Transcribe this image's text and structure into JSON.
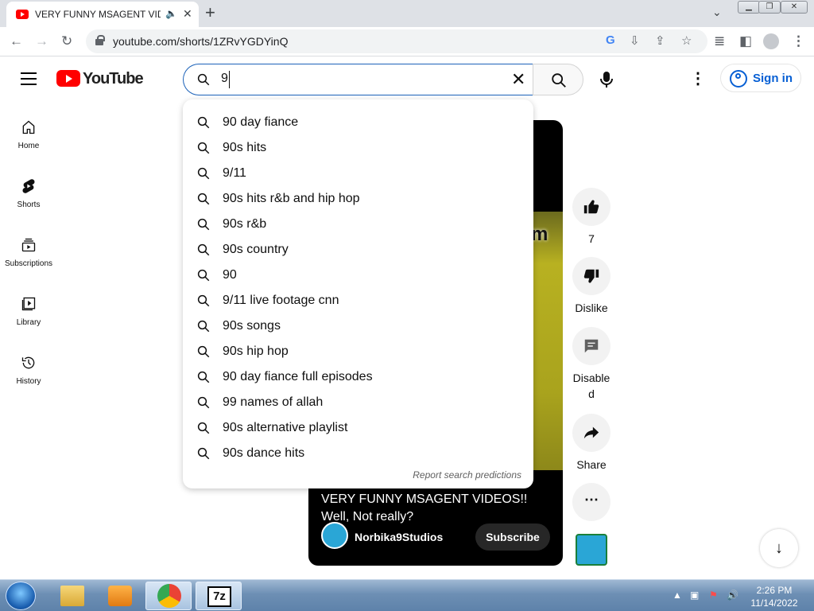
{
  "browser": {
    "tab_title": "VERY FUNNY MSAGENT VIDEOS!! Well, Not really?",
    "new_tab": "+",
    "url": "youtube.com/shorts/1ZRvYGDYinQ",
    "window_buttons": [
      "minimize",
      "restore",
      "close"
    ]
  },
  "youtube": {
    "logo_text": "YouTube",
    "search_query": "9",
    "sign_in": "Sign in",
    "guide": [
      {
        "label": "Home",
        "icon": "home-icon"
      },
      {
        "label": "Shorts",
        "icon": "shorts-icon"
      },
      {
        "label": "Subscriptions",
        "icon": "subscriptions-icon"
      },
      {
        "label": "Library",
        "icon": "library-icon"
      },
      {
        "label": "History",
        "icon": "history-icon"
      }
    ],
    "suggestions": [
      "90 day fiance",
      "90s hits",
      "9/11",
      "90s hits r&b and hip hop",
      "90s r&b",
      "90s country",
      "90",
      "9/11 live footage cnn",
      "90s songs",
      "90s hip hop",
      "90 day fiance full episodes",
      "99 names of allah",
      "90s alternative playlist",
      "90s dance hits"
    ],
    "report_link": "Report search predictions",
    "short": {
      "overlay_text": "m",
      "caption": "VERY FUNNY MSAGENT VIDEOS!! Well, Not really?",
      "channel": "Norbika9Studios",
      "subscribe": "Subscribe"
    },
    "actions": {
      "like_count": "7",
      "dislike": "Dislike",
      "comments": "Disabled",
      "share": "Share"
    }
  },
  "taskbar": {
    "time": "2:26 PM",
    "date": "11/14/2022",
    "apps": [
      "explorer",
      "media-player",
      "chrome",
      "7zip"
    ]
  },
  "colors": {
    "yt_red": "#ff0000",
    "link_blue": "#065fd4",
    "search_focus": "#1c62b9"
  }
}
